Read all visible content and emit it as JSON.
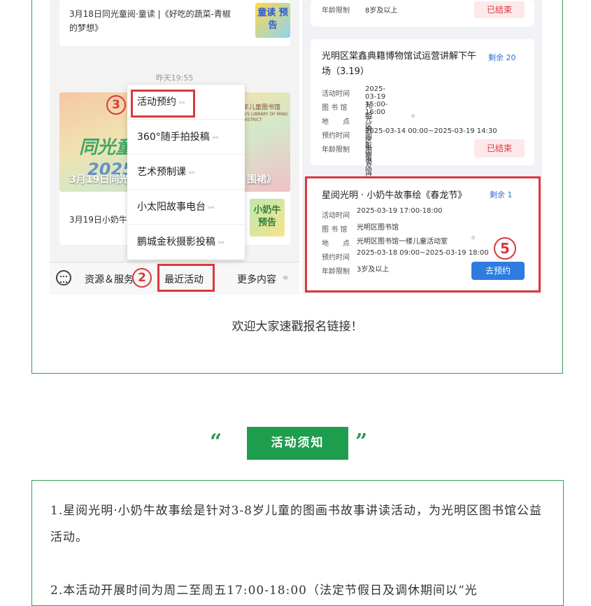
{
  "left_chat": {
    "msg1_text": "3月18日同光童阅·童读 |《好吃的蔬菜-青椒的梦想》",
    "msg1_thumb": "童读 预告",
    "timestamp": "昨天19:55",
    "banner_caption": "3月19日同光",
    "banner_caption_right": "围裙》",
    "banner_small": "N'S LIBRARY OF MING DISTRICT",
    "banner_top": "年儿童图书馆",
    "banner_title": "同光童",
    "banner_year": "2025",
    "msg2_text": "3月19日小奶牛",
    "msg2_thumb": "小奶牛 预告",
    "menu_items": [
      "活动预约",
      "360°随手拍投稿",
      "艺术预制课",
      "小太阳故事电台",
      "鹏城金秋摄影投稿"
    ],
    "bottom_bar": {
      "resources": "资源＆服务",
      "recent": "最近活动",
      "more": "更多内容"
    }
  },
  "callouts": {
    "two": "2",
    "three": "3",
    "five": "5"
  },
  "right_events": {
    "top_partial": {
      "age_label": "年龄限制",
      "age": "8岁及以上",
      "status": "已结束"
    },
    "event2": {
      "title": "光明区棠鑫典籍博物馆试运营讲解下午场（3.19）",
      "remain": "剩余 20",
      "rows": [
        {
          "label": "活动时间",
          "value": "2025-03-19 15:00-16:00"
        },
        {
          "label": "图 书 馆",
          "value": "光明区图书馆"
        },
        {
          "label": "地　　点",
          "value": "光明区图书馆"
        },
        {
          "label": "预约时间",
          "value": "2025-03-14 00:00~2025-03-19 14:30"
        },
        {
          "label": "年龄限制",
          "value": "8岁及以上"
        }
      ],
      "status": "已结束"
    },
    "event3": {
      "title": "星阅光明 · 小奶牛故事绘《春龙节》",
      "remain": "剩余 1",
      "rows": [
        {
          "label": "活动时间",
          "value": "2025-03-19 17:00-18:00"
        },
        {
          "label": "图 书 馆",
          "value": "光明区图书馆"
        },
        {
          "label": "地　　点",
          "value": "光明区图书馆一楼儿童活动室"
        },
        {
          "label": "预约时间",
          "value": "2025-03-18 09:00~2025-03-19 18:00"
        },
        {
          "label": "年龄限制",
          "value": "3岁及以上"
        }
      ],
      "button": "去预约"
    }
  },
  "caption": "欢迎大家速戳报名链接！",
  "section_heading": "活动须知",
  "quote_open": "“",
  "quote_close": "”",
  "notice": {
    "p1": "1.星阅光明·小奶牛故事绘是针对3-8岁儿童的图画书故事讲读活动，为光明区图书馆公益活动。",
    "p2": "2.本活动开展时间为周二至周五17:00-18:00（法定节假日及调休期间以“光"
  },
  "colors": {
    "accent_green": "#1e9d4e",
    "callout_red": "#d9393e",
    "button_blue": "#2f7be0"
  }
}
